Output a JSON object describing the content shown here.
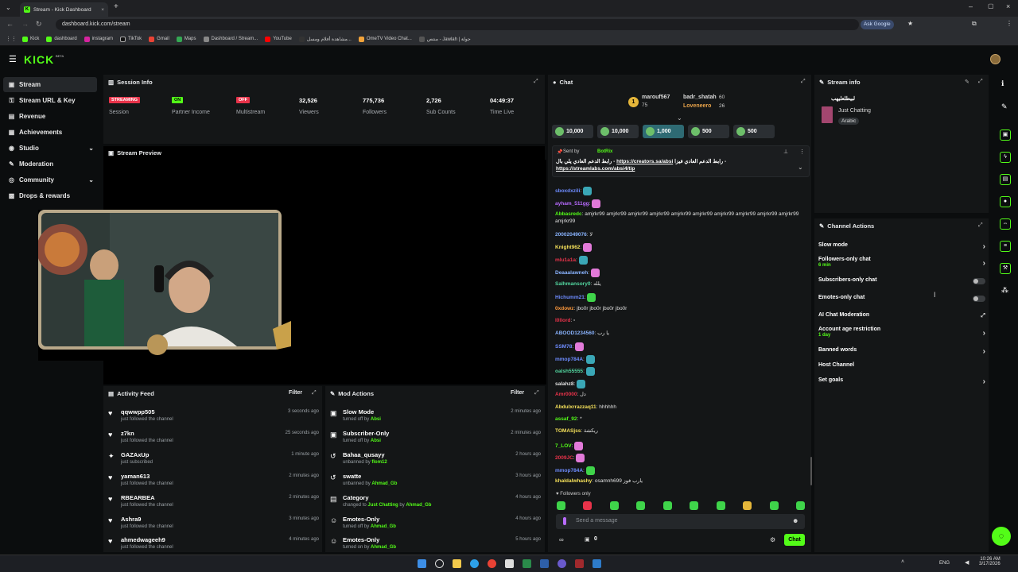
{
  "browser": {
    "tab_title": "Stream - Kick Dashboard",
    "url": "dashboard.kick.com/stream",
    "ask_google": "Ask Google",
    "bookmarks": [
      "Kick",
      "dashboard",
      "instagram",
      "TikTok",
      "Gmail",
      "Maps",
      "Dashboard / Stream...",
      "YouTube",
      "مشاهدة أفلام ومسل...",
      "OmeTV Video Chat...",
      "منتص - Jawlah | جولة"
    ]
  },
  "app": {
    "logo": "KICK",
    "logo_sup": "BETA",
    "accent": "#53fc18"
  },
  "sidebar": {
    "items": [
      {
        "label": "Stream",
        "icon": "stream-icon"
      },
      {
        "label": "Stream URL & Key",
        "icon": "key-icon"
      },
      {
        "label": "Revenue",
        "icon": "revenue-icon"
      },
      {
        "label": "Achievements",
        "icon": "achievements-icon"
      },
      {
        "label": "Studio",
        "icon": "studio-icon"
      },
      {
        "label": "Moderation",
        "icon": "moderation-icon"
      },
      {
        "label": "Community",
        "icon": "community-icon"
      },
      {
        "label": "Drops & rewards",
        "icon": "drops-icon"
      }
    ]
  },
  "session": {
    "title": "Session Info",
    "stats": [
      {
        "badge": "STREAMING",
        "label": "Session",
        "badge_color": "#e8334a"
      },
      {
        "badge": "ON",
        "label": "Partner Income",
        "badge_color": "#53fc18"
      },
      {
        "badge": "OFF",
        "label": "Multistream",
        "badge_color": "#e8334a"
      },
      {
        "value": "32,526",
        "label": "Viewers"
      },
      {
        "value": "775,736",
        "label": "Followers"
      },
      {
        "value": "2,726",
        "label": "Sub Counts"
      },
      {
        "value": "04:49:37",
        "label": "Time Live"
      }
    ]
  },
  "preview": {
    "title": "Stream Preview"
  },
  "activity": {
    "title": "Activity Feed",
    "filter": "Filter",
    "rows": [
      {
        "name": "qqwwpp505",
        "sub": "just followed the channel",
        "time": "3 seconds ago",
        "icon": "heart-icon"
      },
      {
        "name": "z7kn",
        "sub": "just followed the channel",
        "time": "25 seconds ago",
        "icon": "heart-icon"
      },
      {
        "name": "GAZAxUp",
        "sub": "just subscribed",
        "time": "1 minute ago",
        "icon": "sparkle-icon"
      },
      {
        "name": "yaman613",
        "sub": "just followed the channel",
        "time": "2 minutes ago",
        "icon": "heart-icon"
      },
      {
        "name": "RBEARBEA",
        "sub": "just followed the channel",
        "time": "2 minutes ago",
        "icon": "heart-icon"
      },
      {
        "name": "Ashra9",
        "sub": "just followed the channel",
        "time": "3 minutes ago",
        "icon": "heart-icon"
      },
      {
        "name": "ahmedwageeh9",
        "sub": "just followed the channel",
        "time": "4 minutes ago",
        "icon": "heart-icon"
      }
    ]
  },
  "mod": {
    "title": "Mod Actions",
    "filter": "Filter",
    "rows": [
      {
        "name": "Slow Mode",
        "pre": "turned off by",
        "who": "Absi",
        "mid": "",
        "who2": "",
        "time": "2 minutes ago"
      },
      {
        "name": "Subscriber-Only",
        "pre": "turned off by",
        "who": "Absi",
        "mid": "",
        "who2": "",
        "time": "2 minutes ago"
      },
      {
        "name": "Bahaa_qusayy",
        "pre": "unbanned by",
        "who": "flom12",
        "mid": "",
        "who2": "",
        "time": "2 hours ago"
      },
      {
        "name": "swatte",
        "pre": "unbanned by",
        "who": "Ahmad_Gb",
        "mid": "",
        "who2": "",
        "time": "3 hours ago"
      },
      {
        "name": "Category",
        "pre": "changed to",
        "who": "Just Chatting",
        "mid": "by",
        "who2": "Ahmad_Gb",
        "time": "4 hours ago"
      },
      {
        "name": "Emotes-Only",
        "pre": "turned off by",
        "who": "Ahmad_Gb",
        "mid": "",
        "who2": "",
        "time": "4 hours ago"
      },
      {
        "name": "Emotes-Only",
        "pre": "turned on by",
        "who": "Ahmad_Gb",
        "mid": "",
        "who2": "",
        "time": "5 hours ago"
      }
    ]
  },
  "chat": {
    "title": "Chat",
    "leaders": [
      {
        "rank": "1",
        "name": "marouf567",
        "count": "75"
      },
      {
        "name": "badr_shatah",
        "count": "60"
      },
      {
        "name": "Loveneero",
        "count": "26"
      }
    ],
    "gifts": [
      "10,000",
      "10,000",
      "1,000",
      "500",
      "500"
    ],
    "pinned": {
      "sent_by": "Sent by",
      "bot": "BotRix",
      "text_ar": "رابط الدعم العادي يلي بال - ",
      "link1": "https://creators.sa/absi",
      "text2": "رابط الدعم العادي فيزا -",
      "link2": "https://streamlabs.com/absi4/tip"
    },
    "messages": [
      {
        "user": "sboxdxzili",
        "color": "#6e8cff",
        "text": "",
        "emote": "teal"
      },
      {
        "user": "ayham_511gg",
        "color": "#b86bff",
        "text": "",
        "emote": "pink"
      },
      {
        "user": "Abbasredc",
        "color": "#53fc18",
        "text": "amjrkr99 amjrkr99 amjrkr99 amjrkr99 amjrkr99 amjrkr99 amjrkr99 amjrkr99 amjrkr99 amjrkr99 amjrkr99",
        "emote": ""
      },
      {
        "user": "20002049076",
        "color": "#8ab4ff",
        "text": "لا",
        "emote": ""
      },
      {
        "user": "Knight962",
        "color": "#f4e05a",
        "text": "",
        "emote": "pink"
      },
      {
        "user": "mlu1a1a",
        "color": "#e8334a",
        "text": "",
        "emote": "teal"
      },
      {
        "user": "Deaaalawneh",
        "color": "#8ab4ff",
        "text": "",
        "emote": "pink"
      },
      {
        "user": "Salhmansory0",
        "color": "#53d7a0",
        "text": "يلله",
        "emote": ""
      },
      {
        "user": "Hichumm21",
        "color": "#6e8cff",
        "text": "",
        "emote": "green"
      },
      {
        "user": "0xdowz",
        "color": "#ff9a3c",
        "text": "jbo0r jbo0r jbo0r jbo0r",
        "emote": ""
      },
      {
        "user": "l0llord",
        "color": "#e8334a",
        "text": "",
        "emote": ""
      },
      {
        "user": "ABOOD1234560",
        "color": "#8ab4ff",
        "text": "يا رب",
        "emote": ""
      },
      {
        "user": "SSM78",
        "color": "#6e8cff",
        "text": "",
        "emote": "pink"
      },
      {
        "user": "mmop784A",
        "color": "#6e8cff",
        "text": "",
        "emote": "teal"
      },
      {
        "user": "oalsh55555",
        "color": "#53d7a0",
        "text": "",
        "emote": "teal"
      },
      {
        "user": "salahz8",
        "color": "#e0e0e0",
        "text": "",
        "emote": "teal"
      },
      {
        "user": "Amr0000",
        "color": "#e8334a",
        "text": "دل",
        "emote": ""
      },
      {
        "user": "Abdulxrrazzaq11",
        "color": "#f4e05a",
        "text": "hhhhhh",
        "emote": ""
      },
      {
        "user": "assaf_92",
        "color": "#53fc18",
        "text": "*",
        "emote": ""
      },
      {
        "user": "TOMASjss",
        "color": "#f4e05a",
        "text": "ريكشة",
        "emote": ""
      },
      {
        "user": "7_LOV",
        "color": "#53fc18",
        "text": "",
        "emote": "pink"
      },
      {
        "user": "2009JC",
        "color": "#e8334a",
        "text": "",
        "emote": "pink"
      },
      {
        "user": "mmop784A",
        "color": "#6e8cff",
        "text": "",
        "emote": "green"
      },
      {
        "user": "khaldalwhashy",
        "color": "#f4e05a",
        "text": "osamnh699 يارب فوز",
        "emote": ""
      }
    ],
    "followers_only": "Followers only",
    "input_placeholder": "Send a message",
    "chat_button": "Chat",
    "counter": "0"
  },
  "stream_info": {
    "title": "Stream info",
    "stream_title": "لبيطلعليهب",
    "category": "Just Chatting",
    "language": "Arabic"
  },
  "channel_actions": {
    "title": "Channel Actions",
    "items": [
      {
        "label": "Slow mode",
        "sub": "",
        "control": "arrow"
      },
      {
        "label": "Followers-only chat",
        "sub": "6 min",
        "control": "arrow"
      },
      {
        "label": "Subscribers-only chat",
        "sub": "",
        "control": "toggle"
      },
      {
        "label": "Emotes-only chat",
        "sub": "",
        "control": "toggle"
      },
      {
        "label": "AI Chat Moderation",
        "sub": "",
        "control": "external"
      },
      {
        "label": "Account age restriction",
        "sub": "1 day",
        "control": "arrow"
      },
      {
        "label": "Banned words",
        "sub": "",
        "control": "arrow"
      },
      {
        "label": "Host Channel",
        "sub": "",
        "control": ""
      },
      {
        "label": "Set goals",
        "sub": "",
        "control": "arrow"
      }
    ]
  },
  "taskbar": {
    "lang": "ENG",
    "time": "10:26 AM",
    "date": "3/17/2026"
  }
}
